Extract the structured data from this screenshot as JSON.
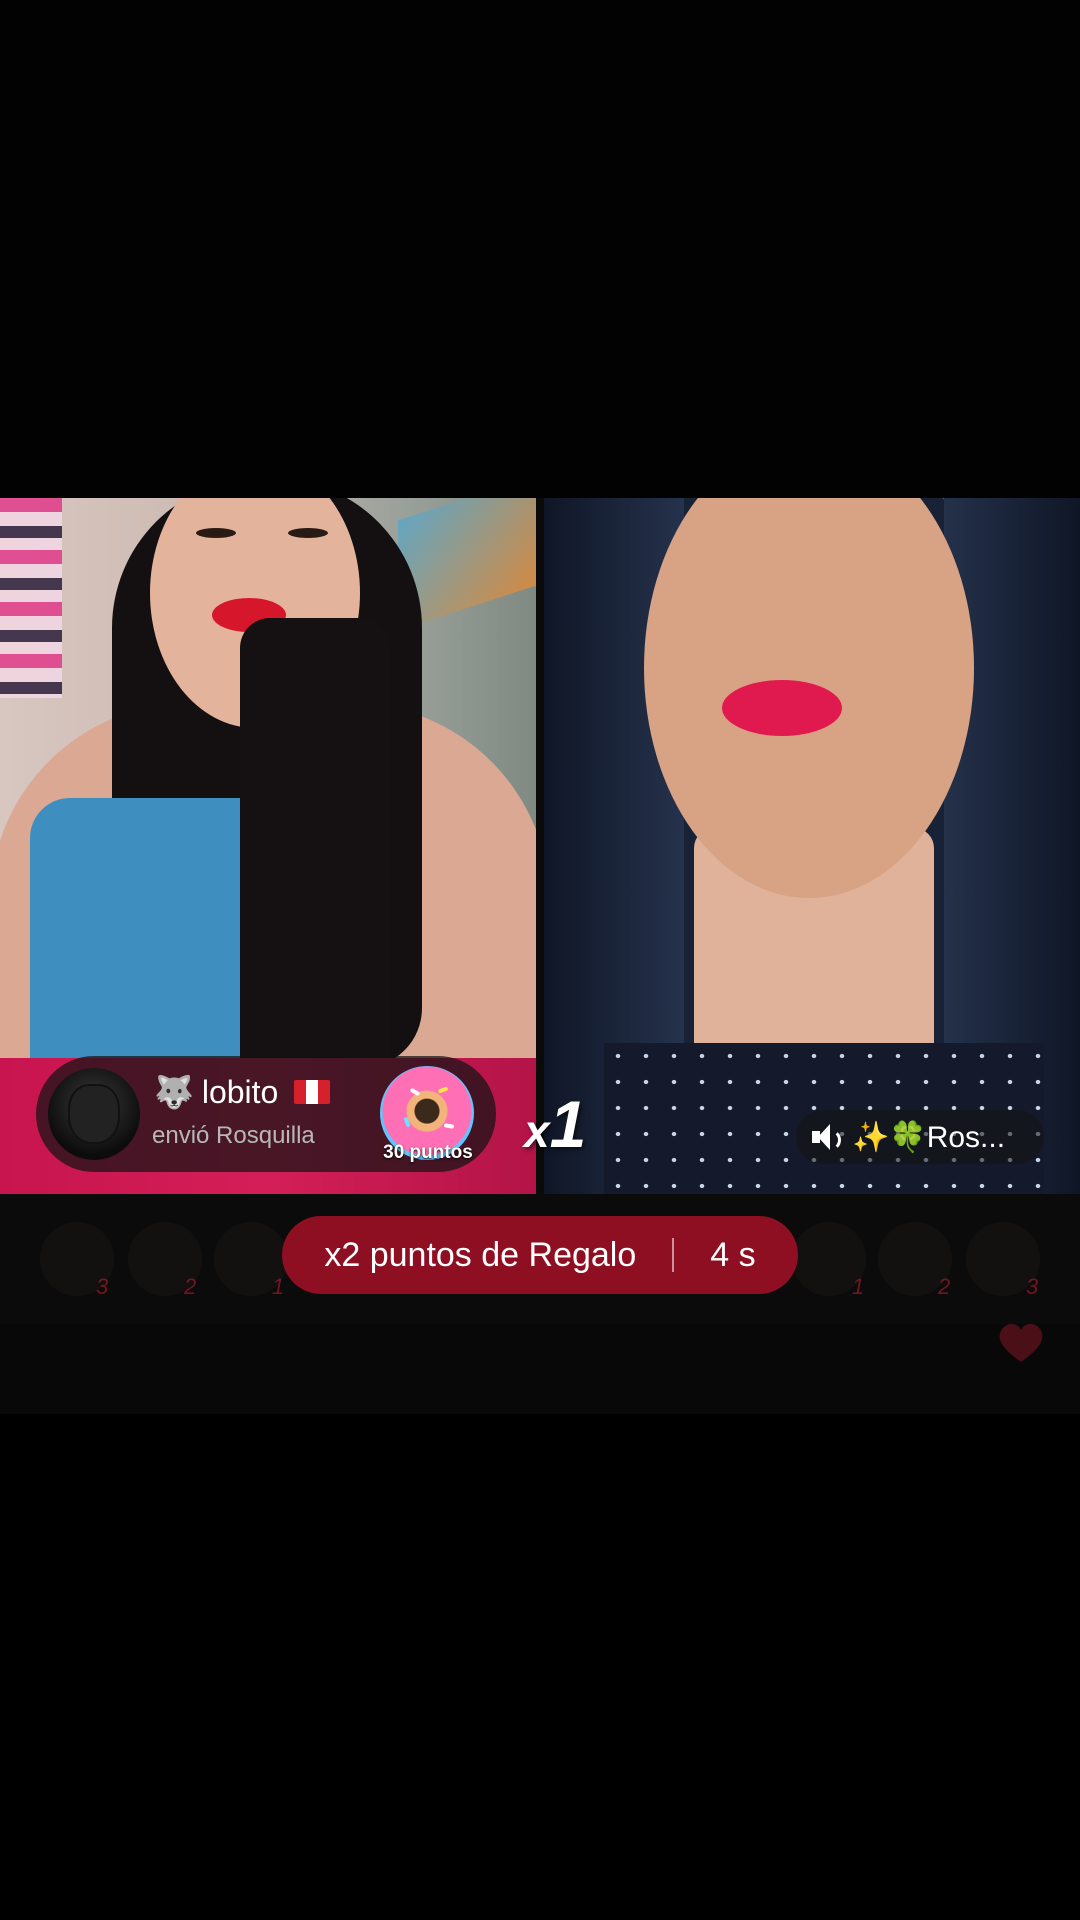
{
  "gift_banner": {
    "username": "lobito",
    "username_icon": "wolf-emoji-icon",
    "flag": "peru-flag-icon",
    "action_text": "envió Rosquilla",
    "gift_name": "Rosquilla",
    "gift_points": "30 puntos",
    "combo_prefix": "x",
    "combo_count": "1"
  },
  "opponent": {
    "name": "✨🍀Ros...",
    "speaker_icon": "speaker-icon"
  },
  "bonus": {
    "label": "x2 puntos de Regalo",
    "timer": "4 s"
  },
  "supporters_left_ranks": [
    "3",
    "2",
    "1"
  ],
  "supporters_right_ranks": [
    "1",
    "2",
    "3"
  ],
  "colors": {
    "bonus_bg": "#8e0f22",
    "rank_red": "#c51d35",
    "background": "#000000"
  }
}
